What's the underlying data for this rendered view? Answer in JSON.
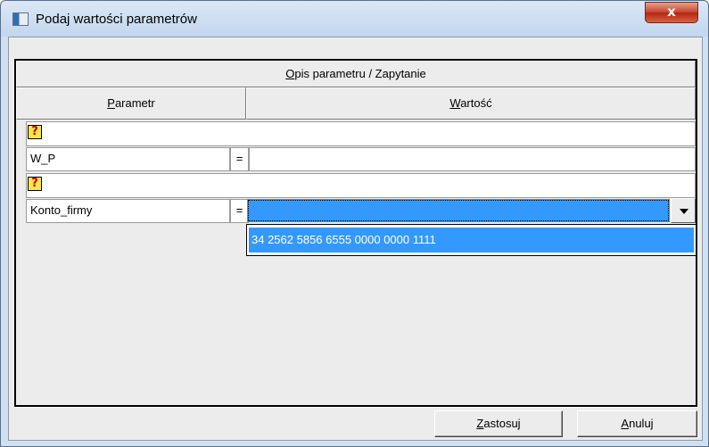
{
  "window": {
    "title": "Podaj wartości parametrów",
    "close_glyph": "x"
  },
  "grid": {
    "header_top": {
      "accel": "O",
      "rest": "pis parametru / Zapytanie"
    },
    "col_param": {
      "accel": "P",
      "rest": "arametr"
    },
    "col_value": {
      "accel": "W",
      "rest": "artość"
    },
    "rows": [
      {
        "question_glyph": "?",
        "name": "W_P",
        "eq": "=",
        "value": ""
      },
      {
        "question_glyph": "?",
        "name": "Konto_firmy",
        "eq": "=",
        "value": ""
      }
    ]
  },
  "dropdown": {
    "selected_option": "34 2562 5856 6555 0000 0000 1111"
  },
  "buttons": {
    "apply": {
      "accel": "Z",
      "rest": "astosuj"
    },
    "cancel": {
      "accel": "A",
      "rest": "nuluj"
    }
  },
  "colors": {
    "selection": "#3399ff",
    "question_bg": "#f6e64a",
    "question_fg": "#d20000"
  }
}
